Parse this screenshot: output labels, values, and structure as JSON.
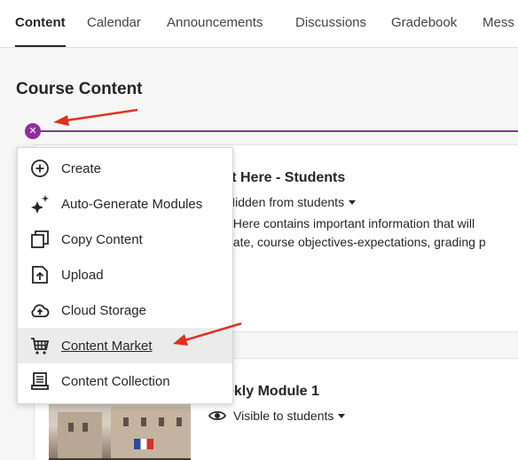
{
  "tabs": [
    {
      "label": "Content",
      "active": true
    },
    {
      "label": "Calendar"
    },
    {
      "label": "Announcements"
    },
    {
      "label": "Discussions"
    },
    {
      "label": "Gradebook"
    },
    {
      "label": "Mess"
    }
  ],
  "page": {
    "title": "Course Content"
  },
  "add_button": {
    "icon": "close-icon",
    "color": "#8c2f9c"
  },
  "menu": {
    "items": [
      {
        "label": "Create",
        "icon": "plus-circle-icon"
      },
      {
        "label": "Auto-Generate Modules",
        "icon": "sparkle-icon"
      },
      {
        "label": "Copy Content",
        "icon": "copy-icon"
      },
      {
        "label": "Upload",
        "icon": "upload-icon"
      },
      {
        "label": "Cloud Storage",
        "icon": "cloud-upload-icon"
      },
      {
        "label": "Content Market",
        "icon": "cart-icon",
        "hovered": true
      },
      {
        "label": "Content Collection",
        "icon": "collection-icon"
      }
    ]
  },
  "content_items": [
    {
      "title": "rt Here - Students",
      "visibility": "Hidden from students",
      "description_lines": [
        ": Here contains important information that will",
        "gate, course objectives-expectations, grading p"
      ]
    },
    {
      "title": "ekly Module 1",
      "visibility": "Visible to students",
      "visibility_icon": "eye-icon"
    }
  ],
  "annotation_color": "#e0301e"
}
